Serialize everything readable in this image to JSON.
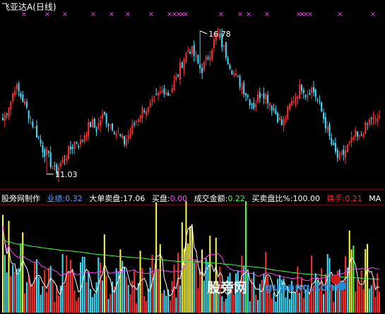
{
  "title": "飞亚达A(日线)",
  "price_labels": {
    "high": "16.78",
    "low": "11.03"
  },
  "indicator_bar": {
    "name": "股旁网制作",
    "items": [
      {
        "label": "业绩:",
        "value": "0.32",
        "color": "#58a0ff"
      },
      {
        "label": "大单卖盘:",
        "value": "17.06",
        "color": "#ffffff"
      },
      {
        "label": "买盘:",
        "value": "0.00",
        "color": "#ff40ff"
      },
      {
        "label": "成交金额:",
        "value": "0.22",
        "color": "#40ff40"
      },
      {
        "label": "买卖盘比%:",
        "value": "100.00",
        "color": "#ffffff"
      },
      {
        "label": "换手:",
        "value": "0.21",
        "color": "#ff2020"
      }
    ],
    "ma_label": "MA"
  },
  "watermark": {
    "cn": "股旁网",
    "en": "gupang.com"
  },
  "colors": {
    "up": "#ff3030",
    "down": "#40e0ff",
    "marker": "#ff40ff",
    "yellow": "#ffff40",
    "green": "#40ff40",
    "white": "#ffffff",
    "magenta": "#ff40ff"
  },
  "chart_data": {
    "type": "candlestick",
    "price_range": [
      10.6,
      17.4
    ],
    "high": 16.78,
    "low": 11.03,
    "ohlc_source": "estimated",
    "close_path": [
      13.2,
      13.6,
      14.0,
      14.6,
      14.3,
      14.0,
      13.6,
      13.2,
      12.8,
      12.4,
      12.0,
      11.8,
      11.4,
      11.1,
      11.4,
      11.6,
      11.9,
      12.1,
      12.4,
      12.2,
      12.6,
      12.9,
      13.1,
      12.8,
      13.2,
      13.4,
      13.1,
      13.0,
      12.7,
      12.5,
      12.3,
      12.6,
      12.9,
      13.2,
      13.5,
      13.7,
      13.6,
      13.9,
      14.1,
      14.3,
      14.5,
      14.2,
      14.6,
      14.9,
      15.4,
      15.8,
      16.1,
      15.9,
      15.5,
      15.2,
      15.5,
      15.9,
      16.3,
      16.7,
      16.3,
      15.9,
      15.5,
      15.1,
      14.8,
      14.6,
      14.3,
      14.0,
      13.8,
      14.1,
      14.4,
      14.2,
      13.9,
      13.6,
      13.3,
      13.0,
      13.4,
      13.8,
      14.1,
      14.4,
      14.6,
      14.2,
      14.5,
      14.3,
      13.9,
      13.4,
      12.9,
      12.3,
      11.9,
      11.6,
      11.8,
      12.1,
      12.3,
      12.6,
      12.4,
      12.8,
      13.0,
      13.3,
      13.1,
      13.4
    ],
    "volume_path": [
      0.9,
      0.7,
      0.5,
      0.6,
      0.4,
      0.5,
      0.3,
      0.4,
      0.5,
      0.3,
      0.2,
      0.4,
      0.3,
      0.2,
      0.3,
      0.5,
      0.4,
      0.3,
      0.2,
      0.3,
      0.4,
      0.3,
      0.2,
      0.3,
      0.4,
      0.6,
      0.3,
      0.2,
      0.3,
      0.4,
      0.3,
      0.2,
      0.3,
      0.2,
      0.4,
      0.3,
      0.2,
      0.5,
      0.7,
      0.4,
      0.3,
      0.2,
      0.4,
      0.3,
      0.6,
      1.0,
      0.7,
      0.5,
      0.3,
      0.4,
      0.3,
      0.5,
      0.6,
      0.4,
      0.3,
      0.2,
      0.3,
      0.2,
      0.3,
      0.4,
      0.3,
      0.2,
      0.3,
      0.2,
      0.3,
      0.4,
      0.3,
      0.2,
      0.3,
      0.2,
      0.3,
      0.2,
      0.4,
      0.3,
      0.2,
      0.3,
      0.5,
      0.3,
      0.2,
      0.3,
      0.4,
      0.3,
      0.2,
      0.3,
      0.4,
      0.6,
      0.5,
      0.3,
      0.2,
      0.4,
      0.5,
      0.3,
      0.2,
      0.3
    ]
  }
}
